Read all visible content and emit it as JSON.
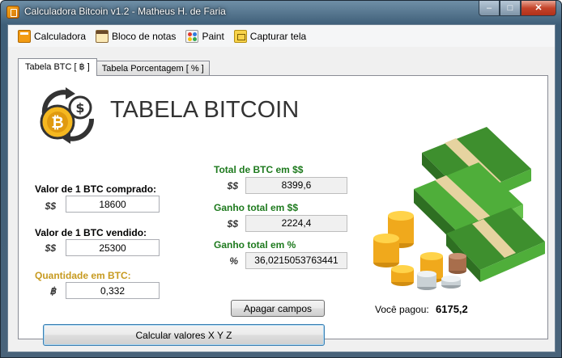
{
  "window": {
    "title": "Calculadora Bitcoin v1.2 - Matheus H. de Faria",
    "minimize": "–",
    "maximize": "□",
    "close": "✕"
  },
  "menu": [
    {
      "label": "Calculadora",
      "icon": "calculator-icon"
    },
    {
      "label": "Bloco de notas",
      "icon": "notepad-icon"
    },
    {
      "label": "Paint",
      "icon": "paint-icon"
    },
    {
      "label": "Capturar tela",
      "icon": "screenshot-icon"
    }
  ],
  "tabs": [
    {
      "label": "Tabela BTC [ ฿ ]",
      "active": true
    },
    {
      "label": "Tabela Porcentagem [ % ]",
      "active": false
    }
  ],
  "heading": "TABELA BITCOIN",
  "inputs": {
    "buy": {
      "label": "Valor de 1 BTC comprado:",
      "currency": "$$",
      "value": "18600"
    },
    "sell": {
      "label": "Valor de 1 BTC vendido:",
      "currency": "$$",
      "value": "25300"
    },
    "qty": {
      "label": "Quantidade em BTC:",
      "currency": "฿",
      "value": "0,332"
    }
  },
  "outputs": {
    "total": {
      "label": "Total de BTC em $$",
      "currency": "$$",
      "value": "8399,6"
    },
    "gain": {
      "label": "Ganho total em $$",
      "currency": "$$",
      "value": "2224,4"
    },
    "gain_pct": {
      "label": "Ganho total em %",
      "currency": "%",
      "value": "36,0215053763441"
    }
  },
  "buttons": {
    "clear": "Apagar campos",
    "calculate": "Calcular valores X Y Z"
  },
  "paid": {
    "label": "Você pagou:",
    "value": "6175,2"
  },
  "colors": {
    "green_label": "#1e7a1e",
    "orange_label": "#c79a20",
    "coin": "#f5b820",
    "cash": "#4fae3a"
  }
}
